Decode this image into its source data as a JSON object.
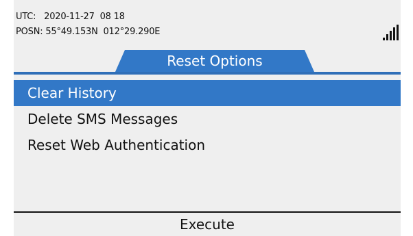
{
  "status": {
    "utc_line": "UTC:   2020-11-27  08 18",
    "posn_line": "POSN: 55°49.153N  012°29.290E"
  },
  "signal_icon": "signal-strength-icon",
  "tab": {
    "label": "Reset Options"
  },
  "menu": {
    "items": [
      {
        "label": "Clear History",
        "selected": true
      },
      {
        "label": "Delete SMS Messages",
        "selected": false
      },
      {
        "label": "Reset Web Authentication",
        "selected": false
      }
    ]
  },
  "softkey": {
    "label": "Execute"
  },
  "colors": {
    "accent": "#3278c7",
    "screen_bg": "#efefef",
    "text": "#111111"
  }
}
